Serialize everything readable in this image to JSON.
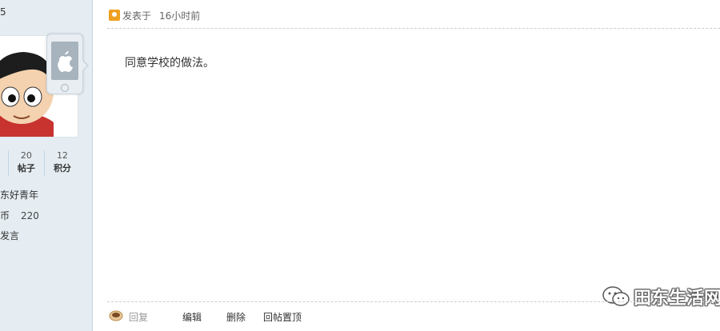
{
  "sidebar": {
    "floor_fragment": "5",
    "stats": [
      {
        "num": "",
        "label": ""
      },
      {
        "num": "20",
        "label": "帖子"
      },
      {
        "num": "12",
        "label": "积分"
      }
    ],
    "user_title": "田东好青年",
    "coins_label": "银币",
    "coins_value": "220",
    "status_text": "止发言"
  },
  "post": {
    "posted_label": "发表于",
    "time": "16小时前",
    "content": "同意学校的做法。"
  },
  "footer": {
    "reply_label": "回复",
    "edit_label": "编辑",
    "delete_label": "删除",
    "pin_label": "回帖置顶"
  },
  "watermark": {
    "text": "田东生活网"
  },
  "colors": {
    "sidebar_bg": "#e5edf2",
    "sidebar_border": "#c2d5e3",
    "post_icon": "#f0a020",
    "divider": "#cdcdcd"
  }
}
